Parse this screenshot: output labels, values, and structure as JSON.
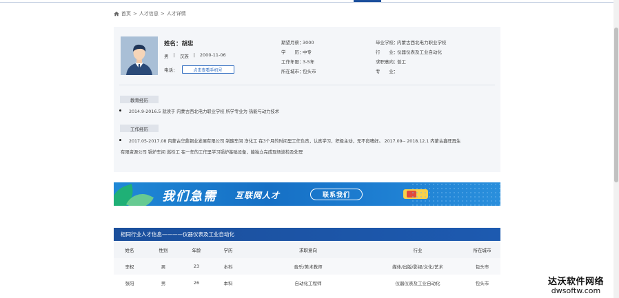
{
  "breadcrumb": {
    "home": "首页",
    "sep1": ">",
    "item2": "人才信息",
    "sep2": ">",
    "item3": "人才详情"
  },
  "profile": {
    "name_line": "姓名：胡忠",
    "gender": "男",
    "sep": "|",
    "ethnicity": "汉族",
    "birth": "2000-11-06",
    "phone_label": "电话：",
    "phone_button": "点击查看手机号",
    "fields_mid": [
      {
        "k": "期望月薪：",
        "v": "3000"
      },
      {
        "k": "学　　历：",
        "v": "中专"
      },
      {
        "k": "工作年限：",
        "v": "3-5年"
      },
      {
        "k": "所在城市：",
        "v": "包头市"
      }
    ],
    "fields_right": [
      {
        "k": "毕业学校：",
        "v": "内蒙古西北电力职业学校"
      },
      {
        "k": "行　　业：",
        "v": "仪器仪表及工业自动化"
      },
      {
        "k": "求职意向：",
        "v": "普工"
      },
      {
        "k": "专　　业：",
        "v": ""
      }
    ]
  },
  "education": {
    "tag": "教育经历",
    "line": "2014.9-2016.5 就读于 内蒙古西北电力职业学校 所学专业为 热能与动力技术"
  },
  "work": {
    "tag": "工作经历",
    "line1": "2017.05-2017.08 内蒙古华鼎铜业发展有限公司 制酸车间 净化工 在3个月的时间里工作负责，认真学习，积极主动，无不良嗜好。 2017.09-- 2018.12.1 内蒙古鑫旺再生",
    "line2": "有限资源公司 锅炉车间 巡检工 在一年的工作里学习锅炉基础设备，能独立完成现场巡检及处理"
  },
  "banner": {
    "title": "我们急需",
    "subtitle": "互联网人才",
    "button": "联系我们"
  },
  "related": {
    "heading": "相同行业人才信息————仪器仪表及工业自动化",
    "columns": [
      "姓名",
      "性别",
      "年龄",
      "学历",
      "求职意向",
      "行业",
      "所在城市"
    ],
    "rows": [
      [
        "李权",
        "男",
        "23",
        "本科",
        "音乐/美术教师",
        "媒体/出版/影视/文化/艺术",
        "包头市"
      ],
      [
        "张阳",
        "男",
        "26",
        "本科",
        "自动化工程师",
        "仪器仪表及工业自动化",
        "包头市"
      ]
    ]
  },
  "watermark": {
    "line1": "达沃软件网络",
    "line2": "dwsoftw.com"
  },
  "colors": {
    "accent": "#1b4f9c",
    "card_bg": "#f4f6f9",
    "banner": "#1670c5"
  }
}
